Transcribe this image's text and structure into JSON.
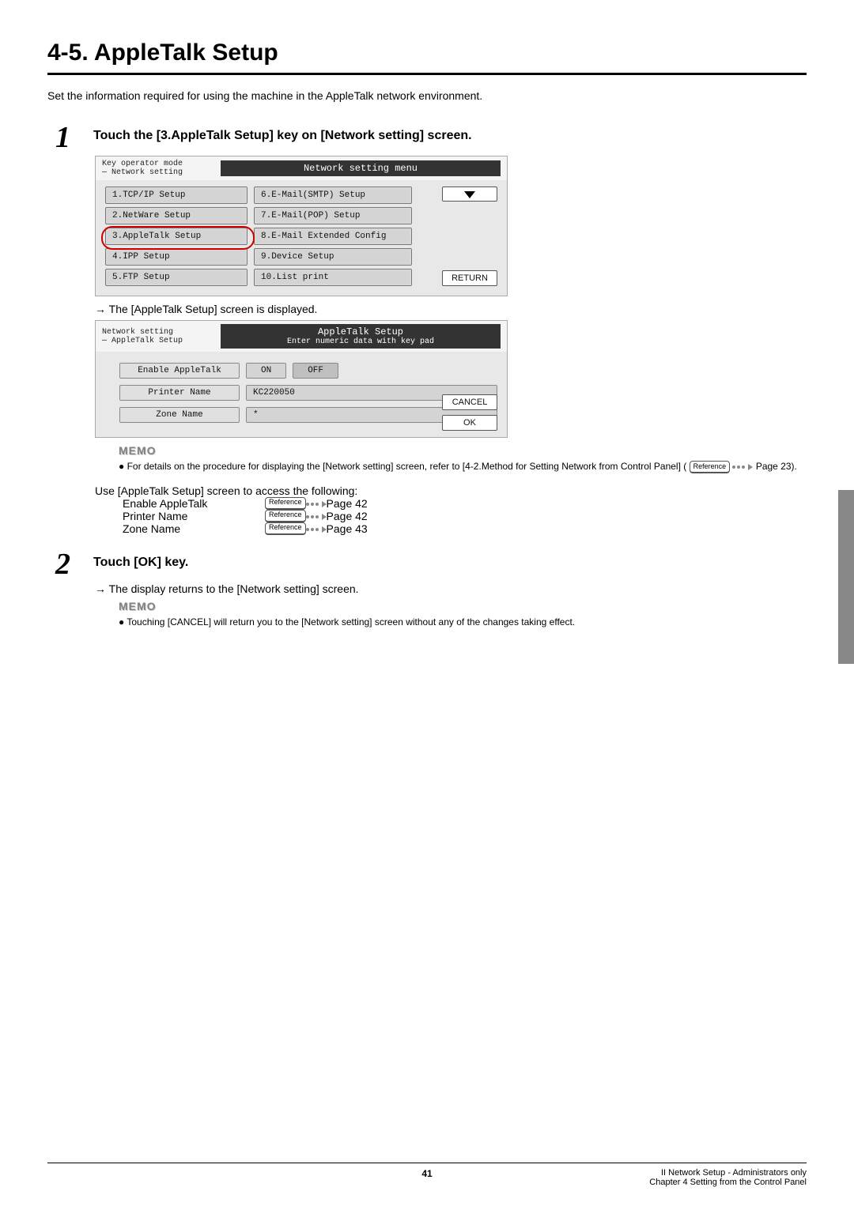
{
  "title": "4-5. AppleTalk Setup",
  "intro": "Set the information required for using the machine in the AppleTalk network environment.",
  "step1": {
    "num": "1",
    "text": "Touch the [3.AppleTalk Setup] key on [Network setting] screen."
  },
  "panel1": {
    "bc1": "Key operator mode",
    "bc2": "— Network setting",
    "title": "Network setting menu",
    "left": [
      "1.TCP/IP Setup",
      "2.NetWare Setup",
      "3.AppleTalk Setup",
      "4.IPP Setup",
      "5.FTP Setup"
    ],
    "mid": [
      "6.E-Mail(SMTP) Setup",
      "7.E-Mail(POP) Setup",
      "8.E-Mail Extended Config",
      "9.Device Setup",
      "10.List print"
    ],
    "return": "RETURN"
  },
  "arrow_note1": "→ The [AppleTalk Setup] screen is displayed.",
  "panel2": {
    "bc1": "Network setting",
    "bc2": "— AppleTalk Setup",
    "title": "AppleTalk Setup",
    "subtitle": "Enter numeric data with key pad",
    "r1_label": "Enable AppleTalk",
    "on": "ON",
    "off": "OFF",
    "r2_label": "Printer Name",
    "r2_value": "KC220050",
    "r3_label": "Zone Name",
    "r3_value": "*",
    "cancel": "CANCEL",
    "ok": "OK"
  },
  "memo_label": "MEMO",
  "memo1_a": "For details on the procedure for displaying the [Network setting] screen, refer to [4-2.Method for Setting Network from Control Panel] (",
  "ref_label": "Reference",
  "memo1_b": " Page 23).",
  "access": {
    "intro": "Use [AppleTalk Setup] screen to access the following:",
    "rows": [
      {
        "label": "Enable AppleTalk",
        "page": " Page 42"
      },
      {
        "label": "Printer Name",
        "page": " Page 42"
      },
      {
        "label": "Zone Name",
        "page": " Page 43"
      }
    ]
  },
  "step2": {
    "num": "2",
    "text": "Touch [OK] key."
  },
  "arrow_note2": "→ The display returns to the [Network setting] screen.",
  "memo2": "Touching [CANCEL] will return you to the [Network setting] screen without any of the changes taking effect.",
  "footer": {
    "page": "41",
    "r1": "II Network Setup - Administrators only",
    "r2": "Chapter 4 Setting from the Control Panel"
  }
}
